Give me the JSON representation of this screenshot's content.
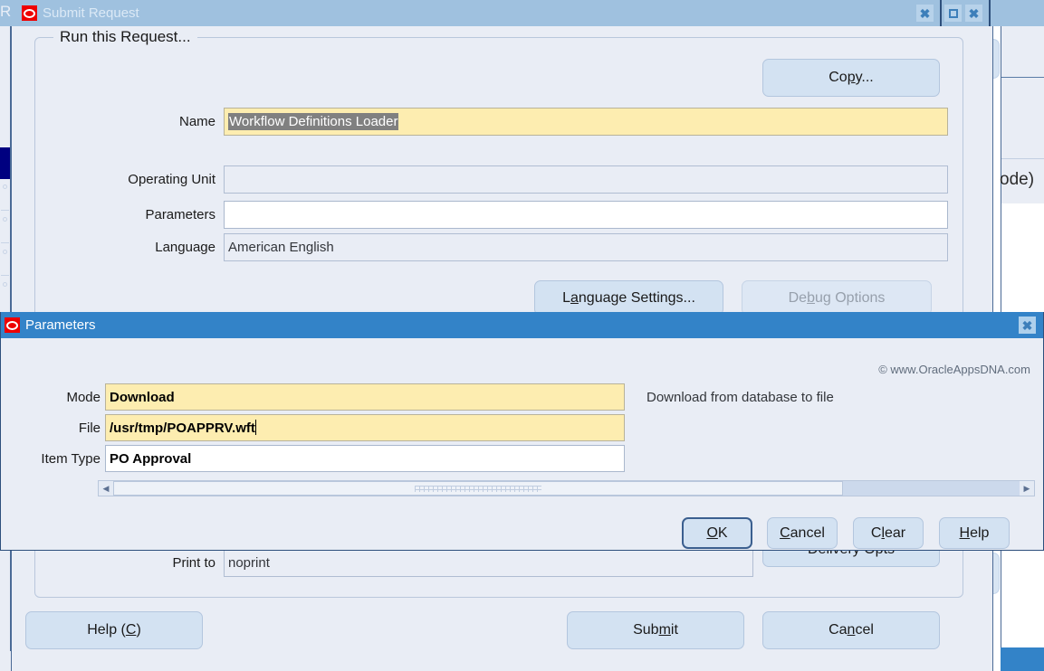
{
  "background": {
    "stray_letter": "R",
    "partial_text": "ode)",
    "navy_marker": "",
    "colors": {
      "inactive_title": "#9fc1df",
      "active_title": "#3383c8",
      "window_face": "#e9edf5",
      "required_field": "#fdedb0",
      "button_face": "#d3e2f2",
      "selection": "#808080",
      "navy": "#000080"
    }
  },
  "submit_request_window": {
    "title": "Submit Request",
    "oracle_logo": "oracle-logo",
    "titlebar_buttons": [
      {
        "name": "close-icon",
        "glyph": "x"
      },
      {
        "name": "maximize-icon",
        "glyph": "square"
      },
      {
        "name": "close-icon",
        "glyph": "x"
      }
    ],
    "group": {
      "title": "Run this Request..."
    },
    "copy_button": {
      "label": "Copy...",
      "mnemonic": "p"
    },
    "fields": [
      {
        "label": "Name",
        "value": "Workflow Definitions Loader",
        "state": "required-selected"
      },
      {
        "label": "Operating Unit",
        "value": "",
        "state": "readonly"
      },
      {
        "label": "Parameters",
        "value": "",
        "state": "white"
      },
      {
        "label": "Language",
        "value": "American English",
        "state": "readonly"
      }
    ],
    "language_settings_button": {
      "label": "Language Settings...",
      "mnemonic": "a",
      "disabled": false
    },
    "debug_options_button": {
      "label": "Debug Options",
      "mnemonic": "b",
      "disabled": true
    },
    "print_to": {
      "label": "Print to",
      "value": "noprint"
    },
    "delivery_opts_button": {
      "label": "Delivery Opts"
    },
    "footer_buttons": [
      {
        "name": "help-button",
        "label": "Help (C)",
        "mnemonic": "C"
      },
      {
        "name": "submit-button",
        "label": "Submit",
        "mnemonic": "m"
      },
      {
        "name": "cancel-button",
        "label": "Cancel",
        "mnemonic": "c"
      }
    ]
  },
  "parameters_dialog": {
    "title": "Parameters",
    "oracle_logo": "oracle-logo",
    "close_button": {
      "name": "close-icon",
      "glyph": "x"
    },
    "watermark": "© www.OracleAppsDNA.com",
    "fields": [
      {
        "label": "Mode",
        "value": "Download",
        "state": "required",
        "hint": "Download from database to file"
      },
      {
        "label": "File",
        "value": "/usr/tmp/POAPPRV.wft",
        "state": "required",
        "caret": true,
        "hint": ""
      },
      {
        "label": "Item Type",
        "value": "PO Approval",
        "state": "white",
        "hint": ""
      }
    ],
    "scrollbar": {
      "left_arrow": "◀",
      "right_arrow": "▶",
      "thumb_percent": 80
    },
    "buttons": [
      {
        "name": "ok-button",
        "label": "OK",
        "mnemonic": "O",
        "default": true
      },
      {
        "name": "cancel-button",
        "label": "Cancel",
        "mnemonic": "C",
        "default": false
      },
      {
        "name": "clear-button",
        "label": "Clear",
        "mnemonic": "l",
        "default": false
      },
      {
        "name": "help-button",
        "label": "Help",
        "mnemonic": "H",
        "default": false
      }
    ]
  }
}
